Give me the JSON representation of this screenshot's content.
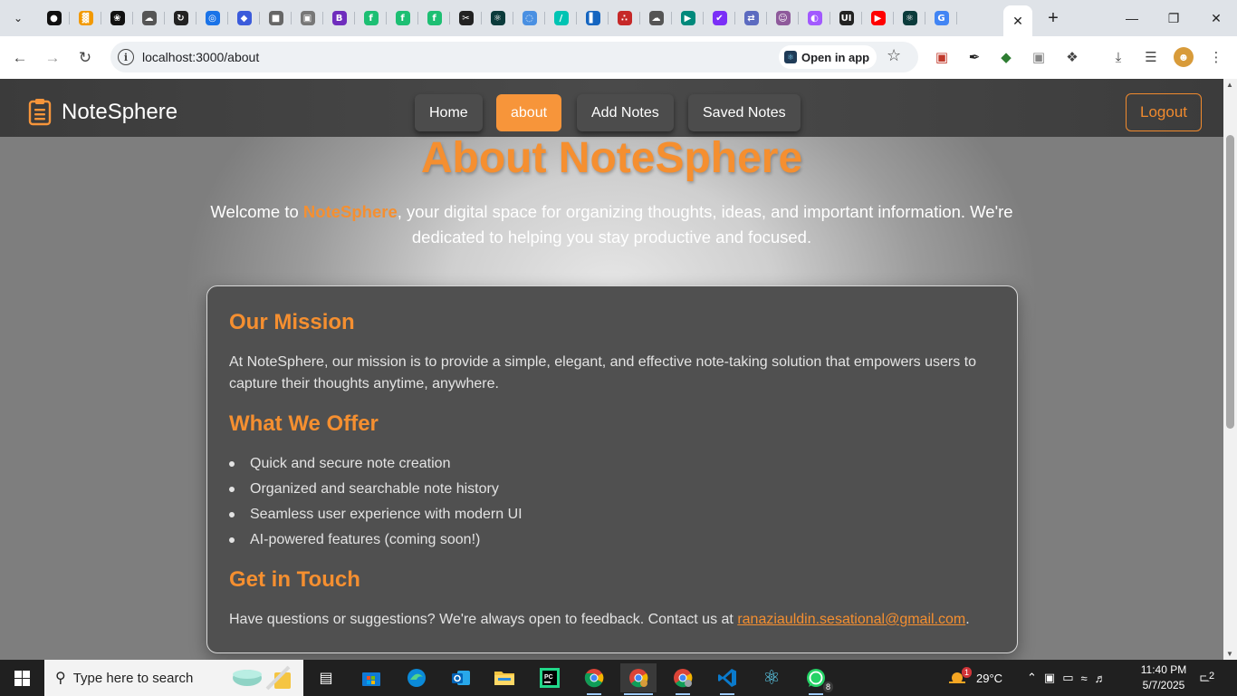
{
  "browser": {
    "url": "localhost:3000/about",
    "open_in_app": "Open in app",
    "new_tab": "+",
    "tabs": [
      {
        "icon": "github-icon",
        "color": "#111111",
        "glyph": "●"
      },
      {
        "icon": "analytics-icon",
        "color": "#f29900",
        "glyph": "▓"
      },
      {
        "icon": "openai-icon",
        "color": "#111111",
        "glyph": "❀"
      },
      {
        "icon": "cloud-icon",
        "color": "#555555",
        "glyph": "☁"
      },
      {
        "icon": "refresh-icon",
        "color": "#222222",
        "glyph": "↻"
      },
      {
        "icon": "globe-icon",
        "color": "#1a73e8",
        "glyph": "◎"
      },
      {
        "icon": "shield-icon",
        "color": "#3b5bdb",
        "glyph": "◆"
      },
      {
        "icon": "puzzle-icon",
        "color": "#666666",
        "glyph": "■"
      },
      {
        "icon": "camera-icon",
        "color": "#777777",
        "glyph": "▣"
      },
      {
        "icon": "bootstrap-icon",
        "color": "#6f2dbd",
        "glyph": "B"
      },
      {
        "icon": "fiverr-icon",
        "color": "#1dbf73",
        "glyph": "f"
      },
      {
        "icon": "fiverr-icon",
        "color": "#1dbf73",
        "glyph": "f"
      },
      {
        "icon": "fiverr-icon",
        "color": "#1dbf73",
        "glyph": "f"
      },
      {
        "icon": "capcut-icon",
        "color": "#222222",
        "glyph": "✂"
      },
      {
        "icon": "react-icon",
        "color": "#0b3b3b",
        "glyph": "⚛"
      },
      {
        "icon": "loading-icon",
        "color": "#4a90e2",
        "glyph": "◌"
      },
      {
        "icon": "design-icon",
        "color": "#00c4b3",
        "glyph": "/"
      },
      {
        "icon": "layout-icon",
        "color": "#1565c0",
        "glyph": "▌"
      },
      {
        "icon": "dots-icon",
        "color": "#c62828",
        "glyph": "∴"
      },
      {
        "icon": "cloud-icon",
        "color": "#555555",
        "glyph": "☁"
      },
      {
        "icon": "play-icon",
        "color": "#00897b",
        "glyph": "▶"
      },
      {
        "icon": "check-icon",
        "color": "#7b2ff7",
        "glyph": "✔"
      },
      {
        "icon": "swap-icon",
        "color": "#5c6bc0",
        "glyph": "⇄"
      },
      {
        "icon": "avatar-icon",
        "color": "#8e5a9b",
        "glyph": "☺"
      },
      {
        "icon": "figma-icon",
        "color": "#a259ff",
        "glyph": "◐"
      },
      {
        "icon": "ui-icon",
        "color": "#222222",
        "glyph": "UI"
      },
      {
        "icon": "youtube-icon",
        "color": "#ff0000",
        "glyph": "▶"
      },
      {
        "icon": "react-icon",
        "color": "#0b3b3b",
        "glyph": "⚛"
      },
      {
        "icon": "google-icon",
        "color": "#4285f4",
        "glyph": "G"
      }
    ]
  },
  "navbar": {
    "brand": "NoteSphere",
    "links": [
      {
        "label": "Home",
        "active": false
      },
      {
        "label": "about",
        "active": true
      },
      {
        "label": "Add Notes",
        "active": false
      },
      {
        "label": "Saved Notes",
        "active": false
      }
    ],
    "logout": "Logout"
  },
  "hero": {
    "title": "About NoteSphere",
    "intro_before": "Welcome to ",
    "intro_highlight": "NoteSphere",
    "intro_after": ", your digital space for organizing thoughts, ideas, and important information. We're dedicated to helping you stay productive and focused."
  },
  "card": {
    "mission_title": "Our Mission",
    "mission_text": "At NoteSphere, our mission is to provide a simple, elegant, and effective note-taking solution that empowers users to capture their thoughts anytime, anywhere.",
    "offer_title": "What We Offer",
    "offer_items": [
      "Quick and secure note creation",
      "Organized and searchable note history",
      "Seamless user experience with modern UI",
      "AI-powered features (coming soon!)"
    ],
    "contact_title": "Get in Touch",
    "contact_text": "Have questions or suggestions? We're always open to feedback. Contact us at ",
    "contact_email": "ranaziauldin.sesational@gmail.com",
    "contact_end": "."
  },
  "taskbar": {
    "search_placeholder": "Type here to search",
    "weather": "29°C",
    "weather_badge": "1",
    "time": "11:40 PM",
    "date": "5/7/2025",
    "notifications": "2",
    "whatsapp_badge": "8"
  },
  "colors": {
    "accent": "#f58f30",
    "navbar": "#444444",
    "card": "#505050"
  }
}
